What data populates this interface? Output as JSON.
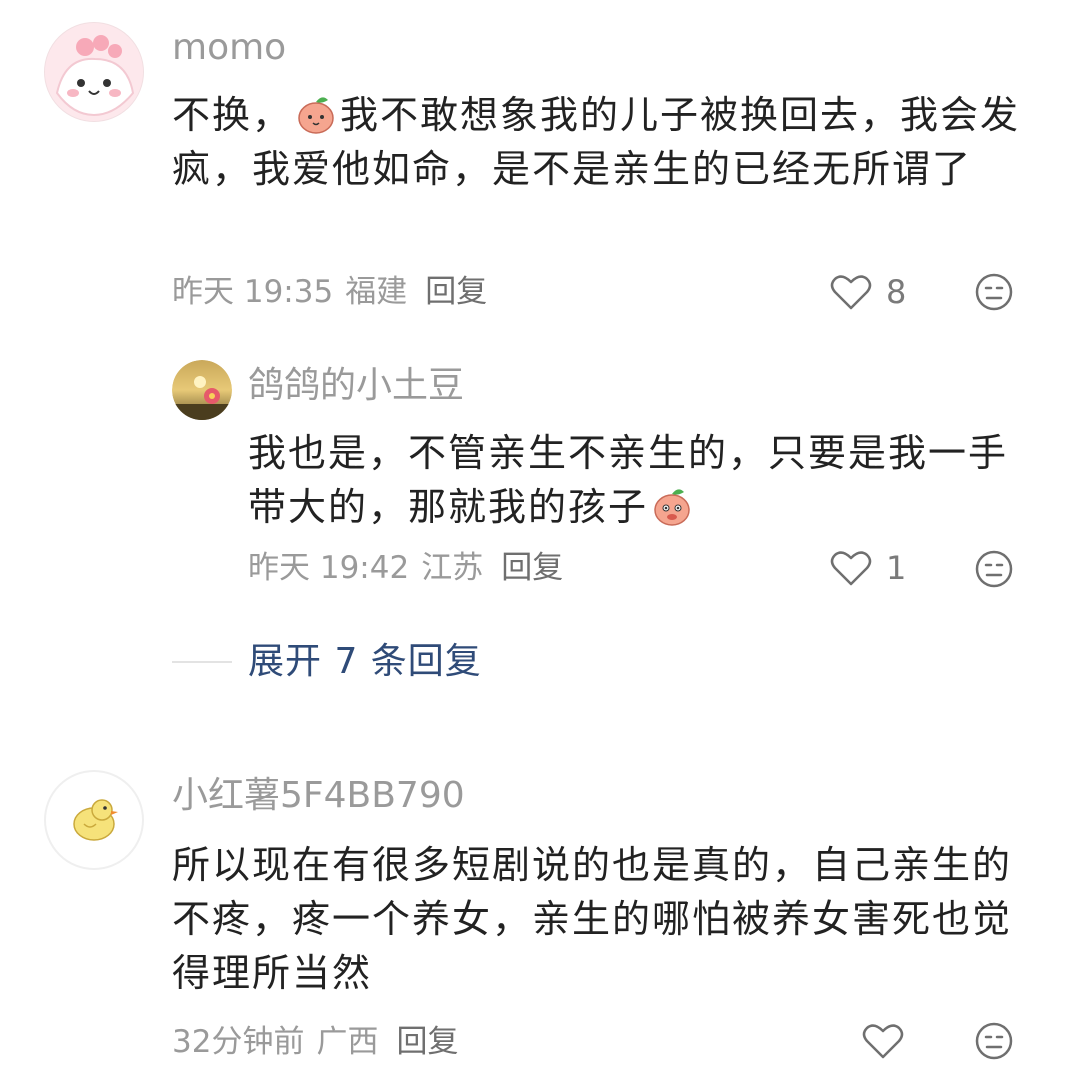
{
  "comments": [
    {
      "username": "momo",
      "content_before": "不换，",
      "content_after": "我不敢想象我的儿子被换回去，我会发疯，我爱他如命，是不是亲生的已经无所谓了",
      "time": "昨天 19:35",
      "location": "福建",
      "reply_label": "回复",
      "likes": "8"
    },
    {
      "username": "鸽鸽的小土豆",
      "content_before": "我也是，不管亲生不亲生的，只要是我一手带大的，那就我的孩子",
      "content_after": "",
      "time": "昨天 19:42",
      "location": "江苏",
      "reply_label": "回复",
      "likes": "1"
    },
    {
      "username": "小红薯5F4BB790",
      "content_before": "所以现在有很多短剧说的也是真的，自己亲生的不疼，疼一个养女，亲生的哪怕被养女害死也觉得理所当然",
      "content_after": "",
      "time": "32分钟前",
      "location": "广西",
      "reply_label": "回复",
      "likes": ""
    }
  ],
  "expand_replies": "展开 7 条回复",
  "icons": {
    "like": "heart-outline-icon",
    "dislike": "meh-face-icon",
    "emoji": "peach-sticker-icon"
  },
  "colors": {
    "text": "#222222",
    "meta": "#9a9a9a",
    "link": "#2f4b78"
  }
}
